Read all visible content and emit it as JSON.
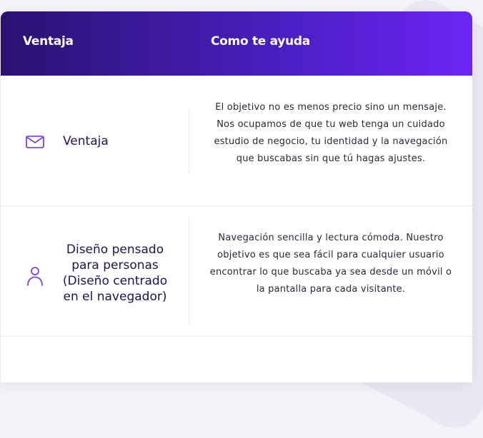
{
  "table": {
    "headers": {
      "advantage": "Ventaja",
      "how_it_helps": "Como te ayuda"
    },
    "rows": [
      {
        "icon": "mail-icon",
        "title": "Ventaja",
        "description": "El objetivo no es menos precio sino un mensaje. Nos ocupamos de que tu web tenga un cuidado estudio de negocio, tu identidad y la navegación que buscabas sin que tú hagas ajustes."
      },
      {
        "icon": "user-icon",
        "title": "Diseño pensado para personas (Diseño centrado en el navegador)",
        "description": "Navegación sencilla y lectura cómoda. Nuestro objetivo es que sea fácil para cualquier usuario encontrar lo que buscaba ya sea desde un móvil o la pantalla para cada visitante."
      }
    ]
  },
  "colors": {
    "header_gradient_start": "#2a1170",
    "header_gradient_end": "#6b24f5",
    "icon_accent": "#6b2bf0",
    "title_text": "#22105a"
  }
}
